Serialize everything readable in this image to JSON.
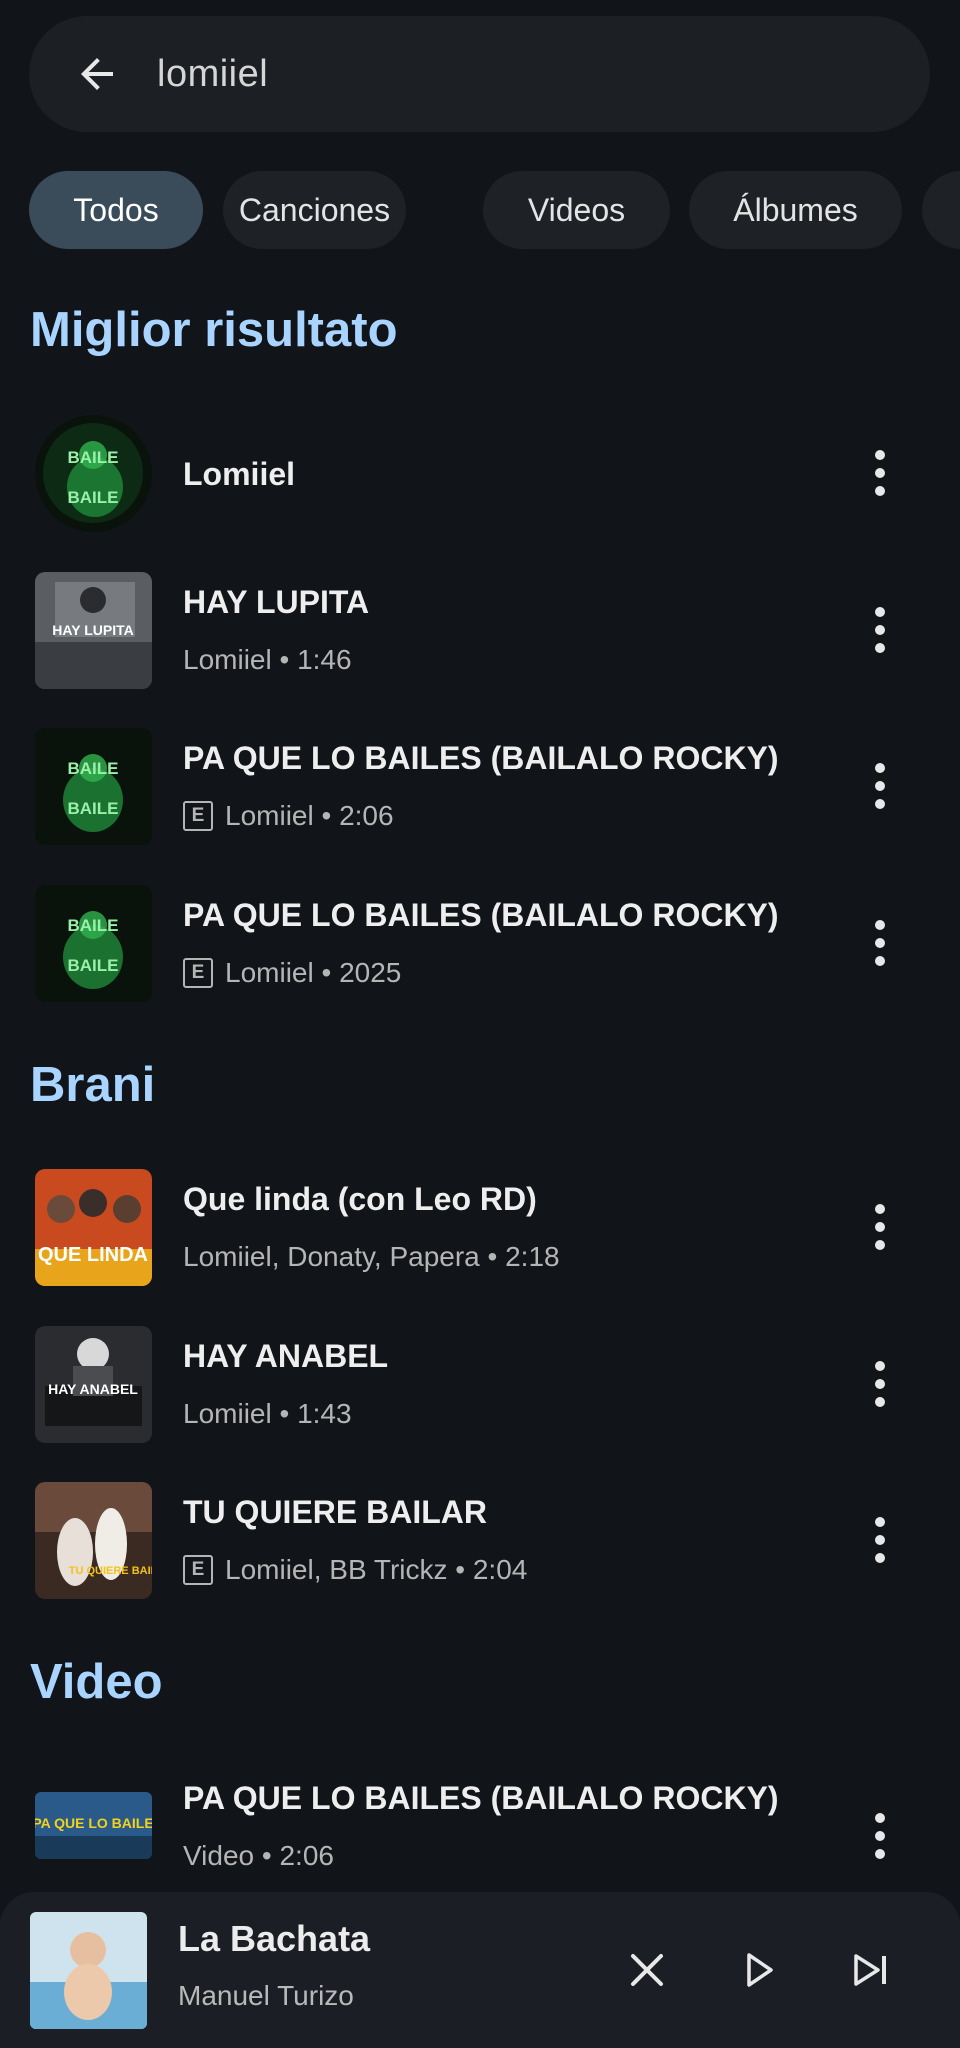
{
  "search": {
    "query": "lomiiel"
  },
  "chips": [
    "Todos",
    "Canciones",
    "Videos",
    "Álbumes"
  ],
  "sections": {
    "top": "Miglior risultato",
    "songs": "Brani",
    "videos": "Video"
  },
  "top_results": [
    {
      "title": "Lomiiel",
      "subtitle": "",
      "explicit": false
    },
    {
      "title": "HAY LUPITA",
      "subtitle": "Lomiiel • 1:46",
      "explicit": false
    },
    {
      "title": "PA QUE LO BAILES (BAILALO ROCKY)",
      "subtitle": "Lomiiel • 2:06",
      "explicit": true
    },
    {
      "title": "PA QUE LO BAILES (BAILALO ROCKY)",
      "subtitle": "Lomiiel • 2025",
      "explicit": true
    }
  ],
  "songs": [
    {
      "title": "Que linda (con Leo RD)",
      "subtitle": "Lomiiel, Donaty, Papera • 2:18",
      "explicit": false
    },
    {
      "title": "HAY ANABEL",
      "subtitle": "Lomiiel • 1:43",
      "explicit": false
    },
    {
      "title": "TU QUIERE BAILAR",
      "subtitle": "Lomiiel, BB Trickz • 2:04",
      "explicit": true
    }
  ],
  "videos": [
    {
      "title": "PA QUE LO BAILES (BAILALO ROCKY)",
      "subtitle": "Video • 2:06",
      "explicit": false
    }
  ],
  "explicit_badge": "E",
  "thumb_text": {
    "baile": "BAILE",
    "lupita": "HAY LUPITA",
    "anabel": "HAY ANABEL",
    "que_linda": "QUE LINDA",
    "tu_quiere": "TU QUIERE BAILAR",
    "video": "PA QUE LO BAILE"
  },
  "player": {
    "title": "La Bachata",
    "artist": "Manuel Turizo"
  },
  "colors": {
    "background": "#111418",
    "accent": "#a8d4ff",
    "chip_active": "#3a4b5a",
    "chip": "#1e2227"
  }
}
